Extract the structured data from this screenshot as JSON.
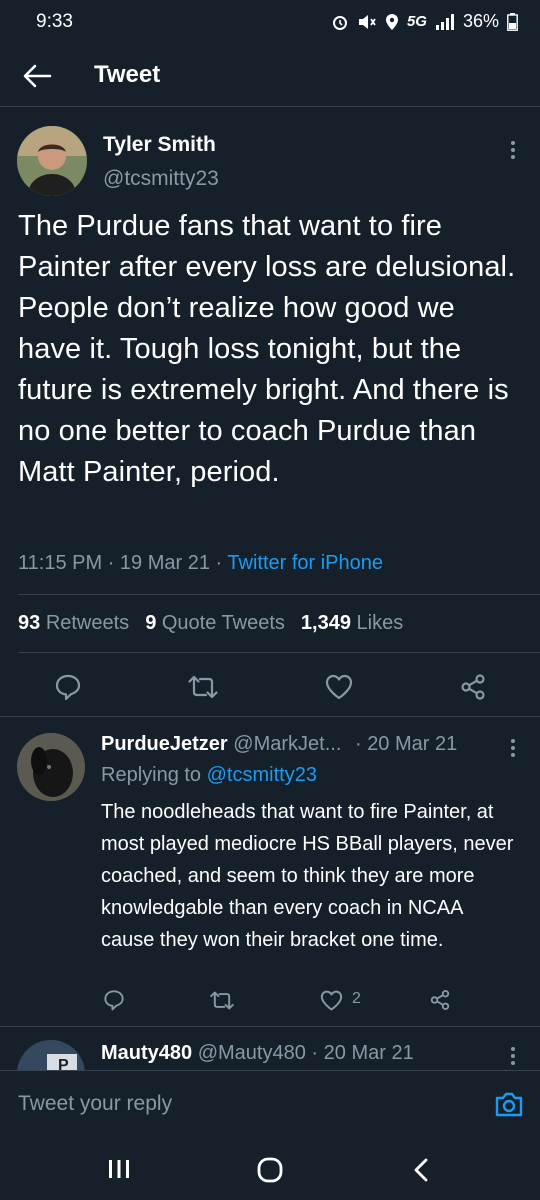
{
  "status_bar": {
    "time": "9:33",
    "network": "5G",
    "battery": "36%"
  },
  "header": {
    "title": "Tweet"
  },
  "tweet": {
    "author_name": "Tyler Smith",
    "author_handle": "@tcsmitty23",
    "text": "The Purdue fans that want to fire Painter after every loss are delusional. People don’t realize how good we have it. Tough loss tonight, but the future is extremely bright. And there is no one better to coach Purdue than Matt Painter, period.",
    "time": "11:15 PM",
    "date": "19 Mar 21",
    "source": "Twitter for iPhone",
    "retweets_count": "93",
    "retweets_label": "Retweets",
    "quotes_count": "9",
    "quotes_label": "Quote Tweets",
    "likes_count": "1,349",
    "likes_label": "Likes"
  },
  "reply1": {
    "author_name": "PurdueJetzer",
    "author_handle": "@MarkJet...",
    "date": "20 Mar 21",
    "replying_prefix": "Replying to",
    "replying_handle": "@tcsmitty23",
    "text": "The noodleheads that want to fire Painter, at most played mediocre HS BBall players, never coached, and seem to think they are more knowledgable than every coach in NCAA cause they won their bracket one time.",
    "like_count": "2"
  },
  "reply2": {
    "author_name": "Mauty480",
    "author_handle": "@Mauty480",
    "date": "20 Mar 21"
  },
  "compose": {
    "placeholder": "Tweet your reply"
  },
  "colors": {
    "background": "#15202b",
    "accent": "#1d9bf0",
    "muted": "#8899a6",
    "divider": "#38444d"
  },
  "icons": [
    "back-arrow-icon",
    "more-icon",
    "reply-icon",
    "retweet-icon",
    "like-icon",
    "share-icon",
    "camera-icon",
    "recents-icon",
    "home-icon",
    "back-nav-icon"
  ]
}
